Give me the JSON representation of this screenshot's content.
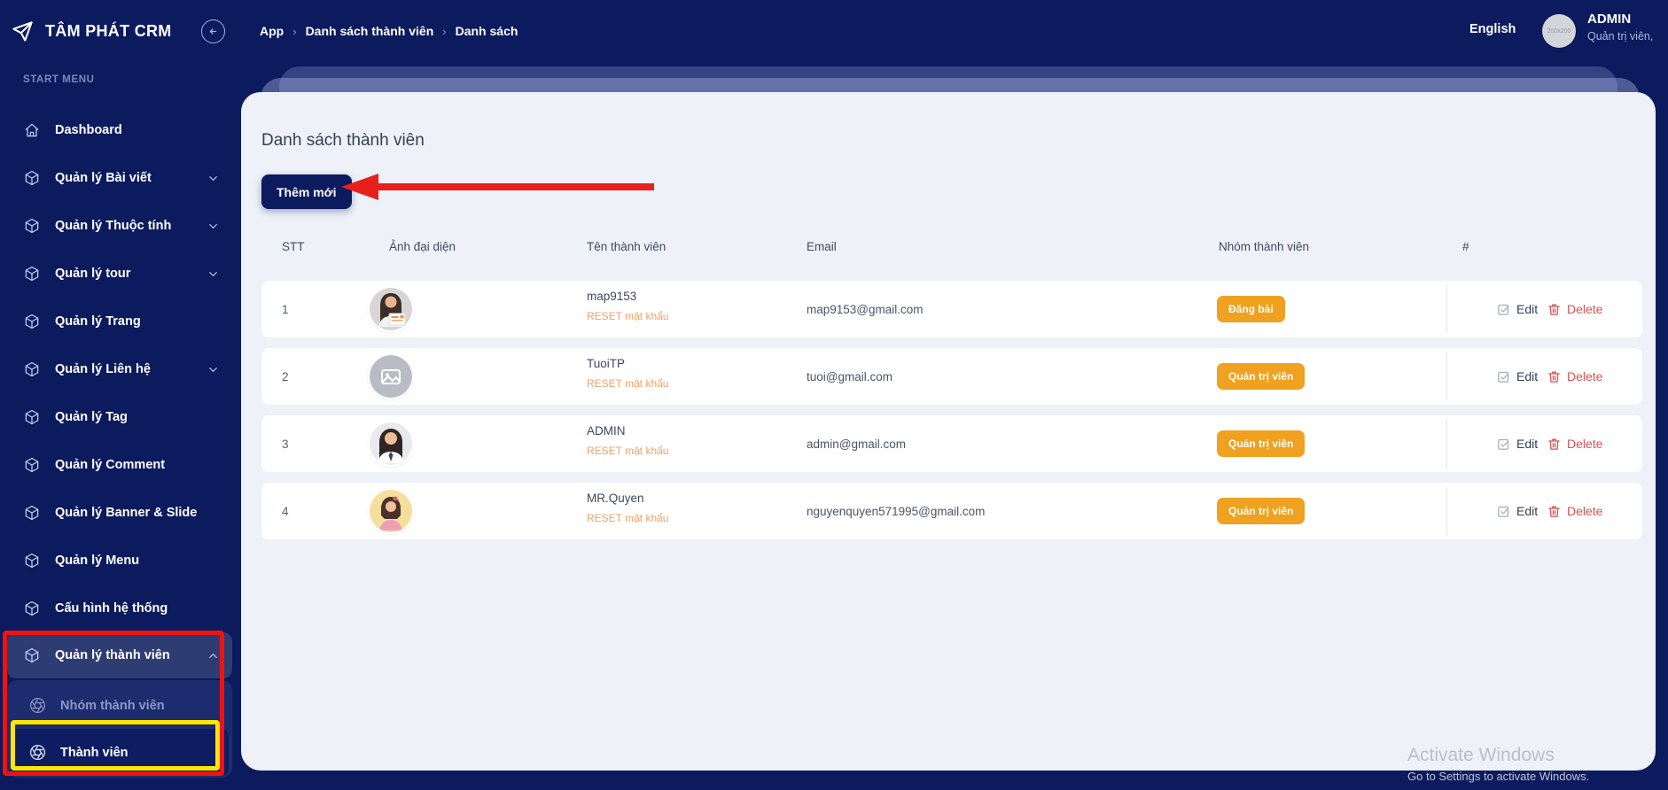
{
  "colors": {
    "navy": "#0c1a5e",
    "active_item": "#2e3c74",
    "card_bg": "#eef1f7",
    "badge_amber": "#efa11f",
    "reset_orange": "#f0a168",
    "delete_red": "#d95252",
    "annotation_red": "#ee1311",
    "annotation_yellow": "#fee600"
  },
  "header": {
    "logo_text": "TÂM PHÁT CRM",
    "breadcrumb": [
      "App",
      "Danh sách thành viên",
      "Danh sách"
    ],
    "breadcrumb_separator": "›",
    "language": "English",
    "user": {
      "name": "ADMIN",
      "role": "Quản trị viên,",
      "avatar_placeholder": "200x200"
    }
  },
  "sidebar": {
    "section_label": "START MENU",
    "items": [
      {
        "label": "Dashboard",
        "icon": "home"
      },
      {
        "label": "Quản lý Bài viết",
        "icon": "cube",
        "chevron": "down"
      },
      {
        "label": "Quản lý Thuộc tính",
        "icon": "cube",
        "chevron": "down"
      },
      {
        "label": "Quản lý tour",
        "icon": "cube",
        "chevron": "down"
      },
      {
        "label": "Quản lý Trang",
        "icon": "cube"
      },
      {
        "label": "Quản lý Liên hệ",
        "icon": "cube",
        "chevron": "down"
      },
      {
        "label": "Quản lý Tag",
        "icon": "cube"
      },
      {
        "label": "Quản lý Comment",
        "icon": "cube"
      },
      {
        "label": "Quản lý Banner & Slide",
        "icon": "cube"
      },
      {
        "label": "Quản lý Menu",
        "icon": "cube"
      },
      {
        "label": "Cấu hình hệ thống",
        "icon": "cube"
      },
      {
        "label": "Quản lý thành viên",
        "icon": "cube",
        "chevron": "up",
        "active": true
      }
    ],
    "submenu": [
      {
        "label": "Nhóm thành viên",
        "icon": "aperture",
        "active": false
      },
      {
        "label": "Thành viên",
        "icon": "aperture",
        "active": true
      }
    ]
  },
  "main": {
    "title": "Danh sách thành viên",
    "add_button": "Thêm mới",
    "table": {
      "headers": [
        "STT",
        "Ảnh đại diện",
        "Tên thành viên",
        "Email",
        "Nhóm thành viên",
        "#"
      ],
      "reset_label": "RESET mật khẩu",
      "edit_label": "Edit",
      "delete_label": "Delete",
      "rows": [
        {
          "stt": "1",
          "name": "map9153",
          "email": "map9153@gmail.com",
          "group": "Đăng bài",
          "avatar": "photo-woman-certificate"
        },
        {
          "stt": "2",
          "name": "TuoiTP",
          "email": "tuoi@gmail.com",
          "group": "Quản trị viên",
          "avatar": "placeholder-image"
        },
        {
          "stt": "3",
          "name": "ADMIN",
          "email": "admin@gmail.com",
          "group": "Quản trị viên",
          "avatar": "photo-woman-white-shirt"
        },
        {
          "stt": "4",
          "name": "MR.Quyen",
          "email": "nguyenquyen571995@gmail.com",
          "group": "Quản trị viên",
          "avatar": "photo-girl-pink"
        }
      ]
    }
  },
  "watermark": {
    "line1": "Activate Windows",
    "line2": "Go to Settings to activate Windows."
  }
}
